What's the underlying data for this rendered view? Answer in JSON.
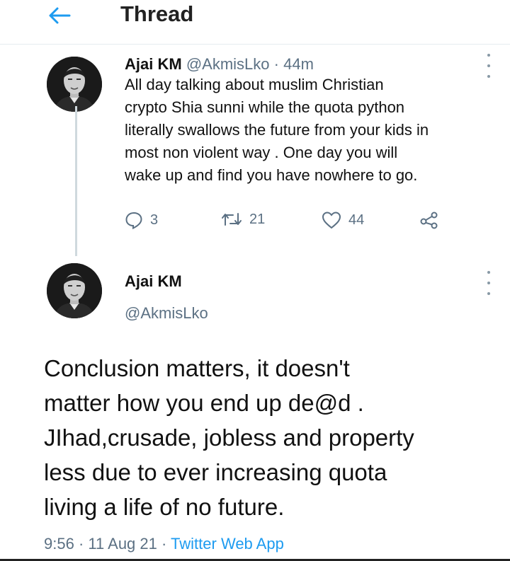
{
  "header": {
    "title": "Thread"
  },
  "tweet1": {
    "name": "Ajai KM",
    "handle": "@AkmisLko",
    "separator": "·",
    "time": "44m",
    "lines": [
      "All day talking about  muslim Christian",
      "crypto Shia sunni while the quota python",
      "literally swallows the future from your kids in",
      "most non violent way . One day you will",
      "wake up and find you have nowhere to go."
    ],
    "reply_count": "3",
    "retweet_count": "21",
    "like_count": "44"
  },
  "tweet2": {
    "name": "Ajai KM",
    "handle": "@AkmisLko",
    "lines": [
      "Conclusion matters, it doesn't",
      "matter how you end up de@d .",
      "JIhad,crusade, jobless and property",
      "less due to ever increasing quota",
      "living a life of no future."
    ],
    "time": "9:56",
    "sep1": "·",
    "date": "11 Aug 21",
    "sep2": "·",
    "source": "Twitter Web App"
  },
  "colors": {
    "accent": "#1d9bf0",
    "muted": "#5b7083",
    "text": "#111111"
  },
  "icons": [
    "back-arrow-icon",
    "more-icon",
    "reply-icon",
    "retweet-icon",
    "like-icon",
    "share-icon"
  ]
}
